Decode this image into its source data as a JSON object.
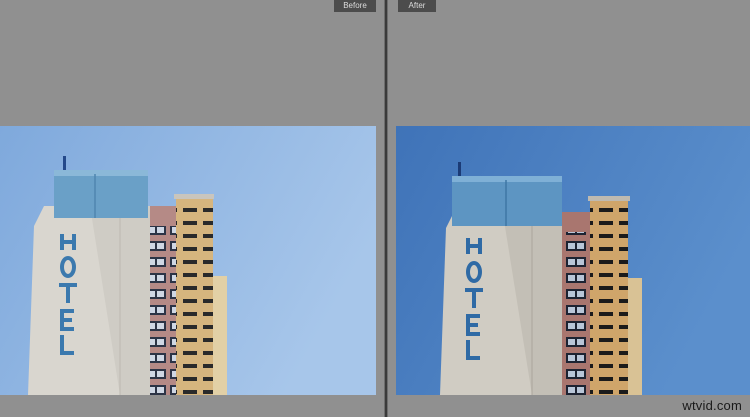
{
  "compare_view": {
    "before_label": "Before",
    "after_label": "After",
    "before_sky_color": "#8fb5e2",
    "after_sky_color": "#4a7fc3"
  },
  "watermark": "wtvid.com"
}
